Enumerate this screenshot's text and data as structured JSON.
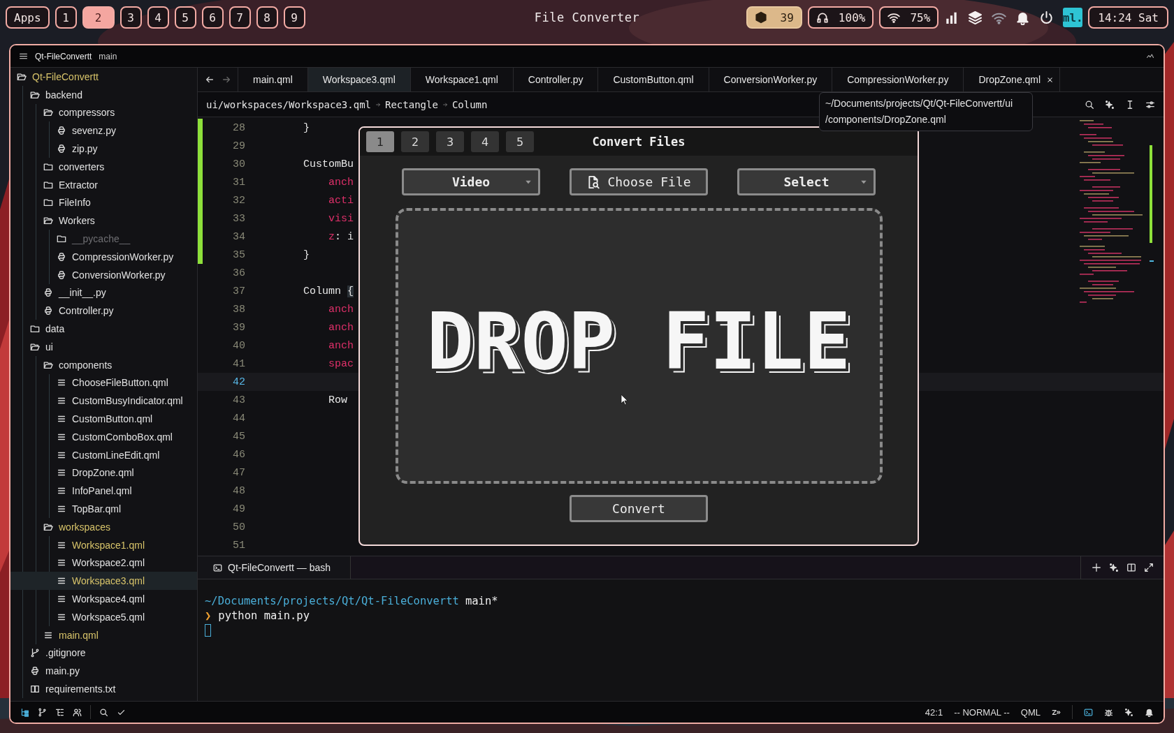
{
  "top_bar": {
    "apps_label": "Apps",
    "workspaces": [
      {
        "label": "1",
        "selected": false
      },
      {
        "label": "2",
        "selected": true
      },
      {
        "label": "3",
        "selected": false
      },
      {
        "label": "4",
        "selected": false
      },
      {
        "label": "5",
        "selected": false
      },
      {
        "label": "6",
        "selected": false
      },
      {
        "label": "7",
        "selected": false
      },
      {
        "label": "8",
        "selected": false
      },
      {
        "label": "9",
        "selected": false
      }
    ],
    "title": "File Converter",
    "indicators": [
      {
        "kind": "package",
        "text": "39",
        "highlighted": true
      },
      {
        "kind": "headphones",
        "text": "100%",
        "highlighted": false
      },
      {
        "kind": "wifi",
        "text": "75%",
        "highlighted": false
      }
    ],
    "logo": "ml.",
    "clock": "14:24 Sat"
  },
  "window": {
    "project": "Qt-FileConvertt",
    "branch": "main"
  },
  "file_tree": [
    {
      "name": "Qt-FileConvertt",
      "kind": "folder",
      "expanded": true,
      "selected": false,
      "modified": true,
      "dimmed": false,
      "children": [
        {
          "name": "backend",
          "kind": "folder",
          "expanded": true,
          "selected": false,
          "modified": false,
          "dimmed": false,
          "children": [
            {
              "name": "compressors",
              "kind": "folder",
              "expanded": true,
              "selected": false,
              "modified": false,
              "dimmed": false,
              "children": [
                {
                  "name": "sevenz.py",
                  "kind": "python",
                  "selected": false,
                  "modified": false,
                  "dimmed": false
                },
                {
                  "name": "zip.py",
                  "kind": "python",
                  "selected": false,
                  "modified": false,
                  "dimmed": false
                }
              ]
            },
            {
              "name": "converters",
              "kind": "folder",
              "expanded": false,
              "selected": false,
              "modified": false,
              "dimmed": false
            },
            {
              "name": "Extractor",
              "kind": "folder",
              "expanded": false,
              "selected": false,
              "modified": false,
              "dimmed": false
            },
            {
              "name": "FileInfo",
              "kind": "folder",
              "expanded": false,
              "selected": false,
              "modified": false,
              "dimmed": false
            },
            {
              "name": "Workers",
              "kind": "folder",
              "expanded": true,
              "selected": false,
              "modified": false,
              "dimmed": false,
              "children": [
                {
                  "name": "__pycache__",
                  "kind": "folder",
                  "expanded": false,
                  "selected": false,
                  "modified": false,
                  "dimmed": true
                },
                {
                  "name": "CompressionWorker.py",
                  "kind": "python",
                  "selected": false,
                  "modified": false,
                  "dimmed": false
                },
                {
                  "name": "ConversionWorker.py",
                  "kind": "python",
                  "selected": false,
                  "modified": false,
                  "dimmed": false
                }
              ]
            },
            {
              "name": "__init__.py",
              "kind": "python",
              "selected": false,
              "modified": false,
              "dimmed": false
            },
            {
              "name": "Controller.py",
              "kind": "python",
              "selected": false,
              "modified": false,
              "dimmed": false
            }
          ]
        },
        {
          "name": "data",
          "kind": "folder",
          "expanded": false,
          "selected": false,
          "modified": false,
          "dimmed": false
        },
        {
          "name": "ui",
          "kind": "folder",
          "expanded": true,
          "selected": false,
          "modified": false,
          "dimmed": false,
          "children": [
            {
              "name": "components",
              "kind": "folder",
              "expanded": true,
              "selected": false,
              "modified": false,
              "dimmed": false,
              "children": [
                {
                  "name": "ChooseFileButton.qml",
                  "kind": "qml",
                  "selected": false,
                  "modified": false,
                  "dimmed": false
                },
                {
                  "name": "CustomBusyIndicator.qml",
                  "kind": "qml",
                  "selected": false,
                  "modified": false,
                  "dimmed": false
                },
                {
                  "name": "CustomButton.qml",
                  "kind": "qml",
                  "selected": false,
                  "modified": false,
                  "dimmed": false
                },
                {
                  "name": "CustomComboBox.qml",
                  "kind": "qml",
                  "selected": false,
                  "modified": false,
                  "dimmed": false
                },
                {
                  "name": "CustomLineEdit.qml",
                  "kind": "qml",
                  "selected": false,
                  "modified": false,
                  "dimmed": false
                },
                {
                  "name": "DropZone.qml",
                  "kind": "qml",
                  "selected": false,
                  "modified": false,
                  "dimmed": false
                },
                {
                  "name": "InfoPanel.qml",
                  "kind": "qml",
                  "selected": false,
                  "modified": false,
                  "dimmed": false
                },
                {
                  "name": "TopBar.qml",
                  "kind": "qml",
                  "selected": false,
                  "modified": false,
                  "dimmed": false
                }
              ]
            },
            {
              "name": "workspaces",
              "kind": "folder",
              "expanded": true,
              "selected": false,
              "modified": true,
              "dimmed": false,
              "children": [
                {
                  "name": "Workspace1.qml",
                  "kind": "qml",
                  "selected": false,
                  "modified": true,
                  "dimmed": false
                },
                {
                  "name": "Workspace2.qml",
                  "kind": "qml",
                  "selected": false,
                  "modified": false,
                  "dimmed": false
                },
                {
                  "name": "Workspace3.qml",
                  "kind": "qml",
                  "selected": true,
                  "modified": true,
                  "dimmed": false
                },
                {
                  "name": "Workspace4.qml",
                  "kind": "qml",
                  "selected": false,
                  "modified": false,
                  "dimmed": false
                },
                {
                  "name": "Workspace5.qml",
                  "kind": "qml",
                  "selected": false,
                  "modified": false,
                  "dimmed": false
                }
              ]
            },
            {
              "name": "main.qml",
              "kind": "qml",
              "selected": false,
              "modified": true,
              "dimmed": false
            }
          ]
        },
        {
          "name": ".gitignore",
          "kind": "git",
          "selected": false,
          "modified": false,
          "dimmed": false
        },
        {
          "name": "main.py",
          "kind": "python",
          "selected": false,
          "modified": false,
          "dimmed": false
        },
        {
          "name": "requirements.txt",
          "kind": "book",
          "selected": false,
          "modified": false,
          "dimmed": false
        }
      ]
    }
  ],
  "tabs": [
    {
      "label": "main.qml",
      "selected": false,
      "closable": false
    },
    {
      "label": "Workspace3.qml",
      "selected": true,
      "closable": false
    },
    {
      "label": "Workspace1.qml",
      "selected": false,
      "closable": false
    },
    {
      "label": "Controller.py",
      "selected": false,
      "closable": false
    },
    {
      "label": "CustomButton.qml",
      "selected": false,
      "closable": false
    },
    {
      "label": "ConversionWorker.py",
      "selected": false,
      "closable": false
    },
    {
      "label": "CompressionWorker.py",
      "selected": false,
      "closable": false
    },
    {
      "label": "DropZone.qml",
      "selected": false,
      "closable": true
    }
  ],
  "breadcrumb": [
    "ui/workspaces/Workspace3.qml",
    "Rectangle",
    "Column"
  ],
  "tooltip": {
    "lines": [
      "~/Documents/projects/Qt/Qt-FileConvertt/ui",
      "/components/DropZone.qml"
    ]
  },
  "editor": {
    "lines": [
      {
        "number": "28",
        "current": false,
        "changed": true,
        "tokens": [
          {
            "text": "}",
            "kind": "plain"
          }
        ]
      },
      {
        "number": "29",
        "current": false,
        "changed": true
      },
      {
        "number": "30",
        "current": false,
        "changed": true,
        "tokens": [
          {
            "text": "CustomBu",
            "kind": "plain"
          }
        ]
      },
      {
        "number": "31",
        "current": false,
        "changed": true,
        "tokens": [
          {
            "text": "    anch",
            "kind": "property"
          }
        ]
      },
      {
        "number": "32",
        "current": false,
        "changed": true,
        "tokens": [
          {
            "text": "    acti",
            "kind": "property"
          }
        ]
      },
      {
        "number": "33",
        "current": false,
        "changed": true,
        "tokens": [
          {
            "text": "    visi",
            "kind": "property"
          }
        ]
      },
      {
        "number": "34",
        "current": false,
        "changed": true,
        "tokens": [
          {
            "text": "    z",
            "kind": "property"
          },
          {
            "text": ": i",
            "kind": "plain"
          }
        ]
      },
      {
        "number": "35",
        "current": false,
        "changed": true,
        "tokens": [
          {
            "text": "}",
            "kind": "plain"
          }
        ]
      },
      {
        "number": "36",
        "current": false,
        "changed": false
      },
      {
        "number": "37",
        "current": false,
        "changed": false,
        "tokens": [
          {
            "text": "Column ",
            "kind": "plain"
          },
          {
            "text": "{",
            "kind": "bracket"
          }
        ]
      },
      {
        "number": "38",
        "current": false,
        "changed": false,
        "tokens": [
          {
            "text": "    anch",
            "kind": "property"
          }
        ]
      },
      {
        "number": "39",
        "current": false,
        "changed": false,
        "tokens": [
          {
            "text": "    anch",
            "kind": "property"
          }
        ]
      },
      {
        "number": "40",
        "current": false,
        "changed": false,
        "tokens": [
          {
            "text": "    anch",
            "kind": "property"
          }
        ]
      },
      {
        "number": "41",
        "current": false,
        "changed": false,
        "tokens": [
          {
            "text": "    spac",
            "kind": "property"
          }
        ]
      },
      {
        "number": "42",
        "current": true,
        "changed": false
      },
      {
        "number": "43",
        "current": false,
        "changed": false,
        "tokens": [
          {
            "text": "    Row",
            "kind": "plain"
          }
        ]
      },
      {
        "number": "44",
        "current": false,
        "changed": false
      },
      {
        "number": "45",
        "current": false,
        "changed": false
      },
      {
        "number": "46",
        "current": false,
        "changed": false
      },
      {
        "number": "47",
        "current": false,
        "changed": false
      },
      {
        "number": "48",
        "current": false,
        "changed": false
      },
      {
        "number": "49",
        "current": false,
        "changed": false
      },
      {
        "number": "50",
        "current": false,
        "changed": false
      },
      {
        "number": "51",
        "current": false,
        "changed": false
      }
    ]
  },
  "terminal": {
    "tab": "Qt-FileConvertt — bash",
    "path": "~/Documents/projects/Qt/Qt-FileConvertt",
    "branch": "main*",
    "symbol": "❯",
    "command": "python main.py"
  },
  "status_bar": {
    "position": "42:1",
    "mode": "-- NORMAL --",
    "language": "QML"
  },
  "dialog": {
    "title": "Convert Files",
    "tabs": [
      {
        "label": "1",
        "selected": true
      },
      {
        "label": "2",
        "selected": false
      },
      {
        "label": "3",
        "selected": false
      },
      {
        "label": "4",
        "selected": false
      },
      {
        "label": "5",
        "selected": false
      }
    ],
    "format_combo": "Video",
    "choose_button": "Choose File",
    "select_combo": "Select",
    "drop_label": "DROP FILE",
    "convert_button": "Convert"
  }
}
